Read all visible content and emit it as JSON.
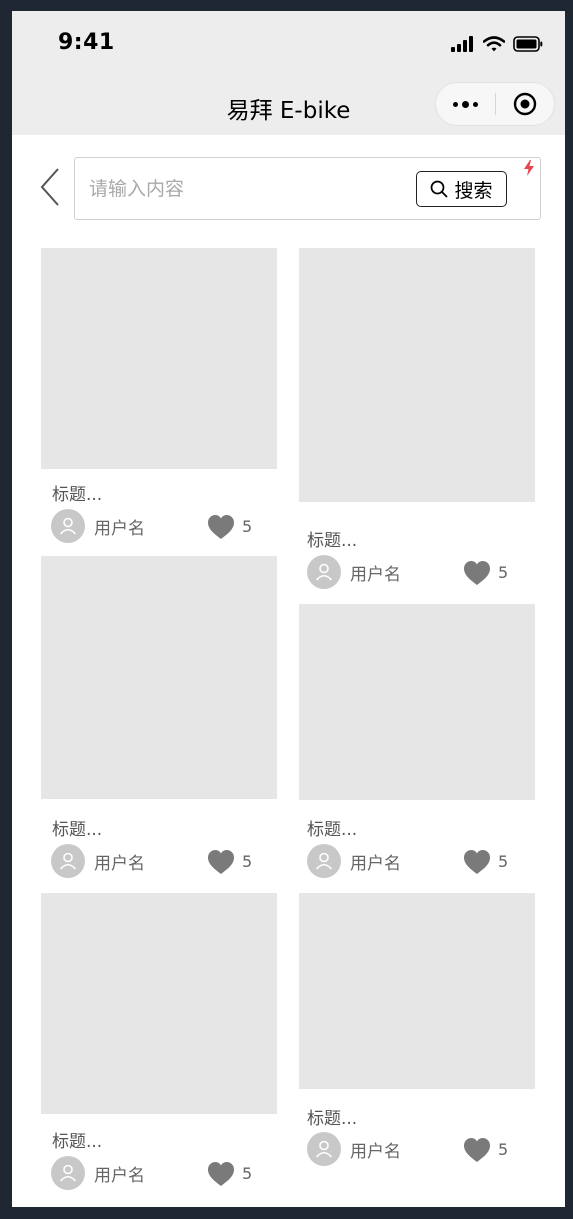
{
  "status_bar": {
    "time": "9:41"
  },
  "nav_bar": {
    "title": "易拜 E-bike"
  },
  "search": {
    "placeholder": "请输入内容",
    "value": "",
    "button_label": "搜索"
  },
  "feed": {
    "cards": [
      {
        "title": "标题...",
        "username": "用户名",
        "likes": "5"
      },
      {
        "title": "标题...",
        "username": "用户名",
        "likes": "5"
      },
      {
        "title": "标题...",
        "username": "用户名",
        "likes": "5"
      },
      {
        "title": "标题...",
        "username": "用户名",
        "likes": "5"
      },
      {
        "title": "标题...",
        "username": "用户名",
        "likes": "5"
      },
      {
        "title": "标题...",
        "username": "用户名",
        "likes": "5"
      }
    ]
  },
  "colors": {
    "status_bar_bg": "#ededed",
    "image_placeholder": "#e6e6e6",
    "heart": "#7a7a7a",
    "avatar": "#c8c8c8",
    "flash_accent": "#e8464f"
  },
  "icons": {
    "back": "chevron-left-icon",
    "search": "search-icon",
    "more": "more-dots-icon",
    "close_miniprogram": "target-icon",
    "like": "heart-icon",
    "avatar": "user-icon",
    "signal": "signal-icon",
    "wifi": "wifi-icon",
    "battery": "battery-icon",
    "flash": "flash-icon"
  }
}
